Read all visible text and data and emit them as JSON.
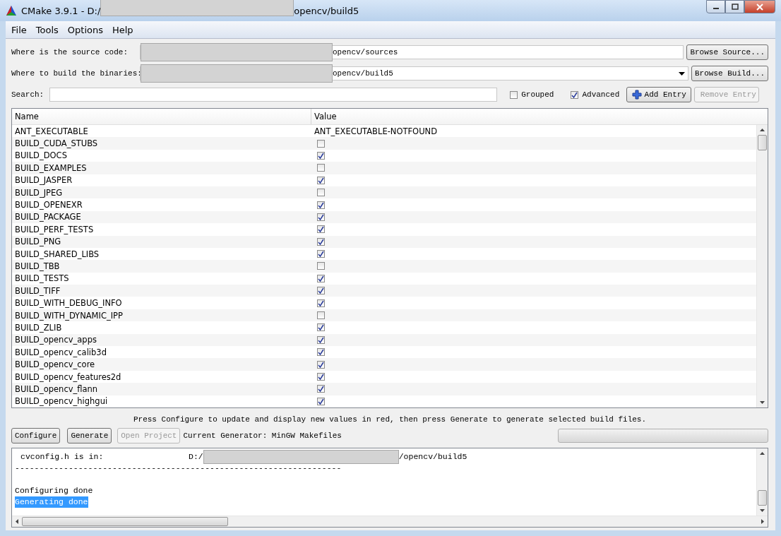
{
  "window": {
    "title_start": "CMake 3.9.1 - D:/",
    "title_end": "opencv/build5"
  },
  "menu": [
    {
      "label": "File"
    },
    {
      "label": "Tools"
    },
    {
      "label": "Options"
    },
    {
      "label": "Help"
    }
  ],
  "source": {
    "label": "Where is the source code:",
    "value_end": "opencv/sources",
    "button": "Browse Source..."
  },
  "build": {
    "label": "Where to build the binaries:",
    "value_end": "opencv/build5",
    "button": "Browse Build..."
  },
  "search": {
    "label": "Search:"
  },
  "options": [
    {
      "label": "Grouped",
      "checked": false
    },
    {
      "label": "Advanced",
      "checked": true
    }
  ],
  "add_entry": {
    "label": "Add Entry",
    "disabled": false
  },
  "remove_entry": {
    "label": "Remove Entry",
    "disabled": true
  },
  "table": {
    "columns": [
      "Name",
      "Value"
    ],
    "rows": [
      {
        "name": "ANT_EXECUTABLE",
        "kind": "text",
        "value": "ANT_EXECUTABLE-NOTFOUND"
      },
      {
        "name": "BUILD_CUDA_STUBS",
        "kind": "bool",
        "checked": false
      },
      {
        "name": "BUILD_DOCS",
        "kind": "bool",
        "checked": true
      },
      {
        "name": "BUILD_EXAMPLES",
        "kind": "bool",
        "checked": false
      },
      {
        "name": "BUILD_JASPER",
        "kind": "bool",
        "checked": true
      },
      {
        "name": "BUILD_JPEG",
        "kind": "bool",
        "checked": false
      },
      {
        "name": "BUILD_OPENEXR",
        "kind": "bool",
        "checked": true
      },
      {
        "name": "BUILD_PACKAGE",
        "kind": "bool",
        "checked": true
      },
      {
        "name": "BUILD_PERF_TESTS",
        "kind": "bool",
        "checked": true
      },
      {
        "name": "BUILD_PNG",
        "kind": "bool",
        "checked": true
      },
      {
        "name": "BUILD_SHARED_LIBS",
        "kind": "bool",
        "checked": true
      },
      {
        "name": "BUILD_TBB",
        "kind": "bool",
        "checked": false
      },
      {
        "name": "BUILD_TESTS",
        "kind": "bool",
        "checked": true
      },
      {
        "name": "BUILD_TIFF",
        "kind": "bool",
        "checked": true
      },
      {
        "name": "BUILD_WITH_DEBUG_INFO",
        "kind": "bool",
        "checked": true
      },
      {
        "name": "BUILD_WITH_DYNAMIC_IPP",
        "kind": "bool",
        "checked": false
      },
      {
        "name": "BUILD_ZLIB",
        "kind": "bool",
        "checked": true
      },
      {
        "name": "BUILD_opencv_apps",
        "kind": "bool",
        "checked": true
      },
      {
        "name": "BUILD_opencv_calib3d",
        "kind": "bool",
        "checked": true
      },
      {
        "name": "BUILD_opencv_core",
        "kind": "bool",
        "checked": true
      },
      {
        "name": "BUILD_opencv_features2d",
        "kind": "bool",
        "checked": true
      },
      {
        "name": "BUILD_opencv_flann",
        "kind": "bool",
        "checked": true
      },
      {
        "name": "BUILD_opencv_highgui",
        "kind": "bool",
        "checked": true
      }
    ]
  },
  "hint": "Press Configure to update and display new values in red, then press Generate to generate selected build files.",
  "actions": [
    {
      "label": "Configure",
      "disabled": false
    },
    {
      "label": "Generate",
      "disabled": false
    },
    {
      "label": "Open Project",
      "disabled": true
    }
  ],
  "generator": "Current Generator: MinGW Makefiles",
  "progress": {
    "level": 0
  },
  "output": [
    {
      "kind": "path",
      "label": "cvconfig.h is in:",
      "prefix": "D:/",
      "suffix": "/opencv/build5"
    },
    {
      "kind": "text",
      "text": "-------------------------------------------------------------------",
      "selected": false
    },
    {
      "kind": "blank"
    },
    {
      "kind": "text",
      "text": "Configuring done",
      "selected": false
    },
    {
      "kind": "text",
      "text": "Generating done",
      "selected": true
    }
  ]
}
